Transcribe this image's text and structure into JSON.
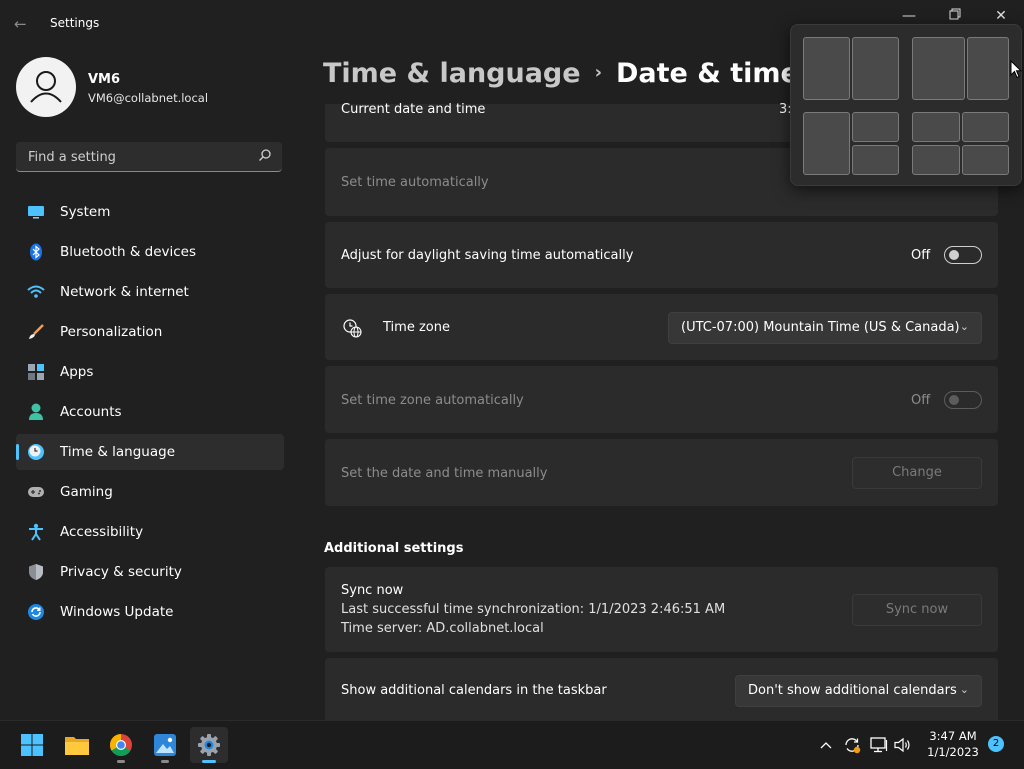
{
  "window": {
    "title": "Settings"
  },
  "user": {
    "name": "VM6",
    "email": "VM6@collabnet.local"
  },
  "search": {
    "placeholder": "Find a setting"
  },
  "sidebar": {
    "items": [
      {
        "label": "System",
        "icon": "system-icon"
      },
      {
        "label": "Bluetooth & devices",
        "icon": "bluetooth-icon"
      },
      {
        "label": "Network & internet",
        "icon": "wifi-icon"
      },
      {
        "label": "Personalization",
        "icon": "brush-icon"
      },
      {
        "label": "Apps",
        "icon": "apps-icon"
      },
      {
        "label": "Accounts",
        "icon": "person-icon"
      },
      {
        "label": "Time & language",
        "icon": "clock-globe-icon",
        "active": true
      },
      {
        "label": "Gaming",
        "icon": "gamepad-icon"
      },
      {
        "label": "Accessibility",
        "icon": "accessibility-icon"
      },
      {
        "label": "Privacy & security",
        "icon": "shield-icon"
      },
      {
        "label": "Windows Update",
        "icon": "update-icon"
      }
    ]
  },
  "breadcrumb": {
    "parent": "Time & language",
    "separator": "›",
    "current": "Date & time"
  },
  "settings": {
    "current_date": {
      "label": "Current date and time",
      "value_partial": "3:"
    },
    "set_time_auto": {
      "label": "Set time automatically"
    },
    "daylight": {
      "label": "Adjust for daylight saving time automatically",
      "state": "Off"
    },
    "timezone": {
      "label": "Time zone",
      "value": "(UTC-07:00) Mountain Time (US & Canada)"
    },
    "set_tz_auto": {
      "label": "Set time zone automatically",
      "state": "Off"
    },
    "manual": {
      "label": "Set the date and time manually",
      "button": "Change"
    }
  },
  "additional": {
    "header": "Additional settings",
    "sync": {
      "title": "Sync now",
      "last_sync": "Last successful time synchronization: 1/1/2023 2:46:51 AM",
      "server": "Time server: AD.collabnet.local",
      "button": "Sync now"
    },
    "calendars": {
      "label": "Show additional calendars in the taskbar",
      "value": "Don't show additional calendars"
    }
  },
  "taskbar": {
    "time": "3:47 AM",
    "date": "1/1/2023",
    "notification_count": "2",
    "apps": [
      "start-icon",
      "file-explorer-icon",
      "chrome-icon",
      "photos-icon",
      "settings-icon"
    ]
  },
  "colors": {
    "accent": "#4cc2ff",
    "background": "#202020",
    "card": "#2b2b2b"
  }
}
